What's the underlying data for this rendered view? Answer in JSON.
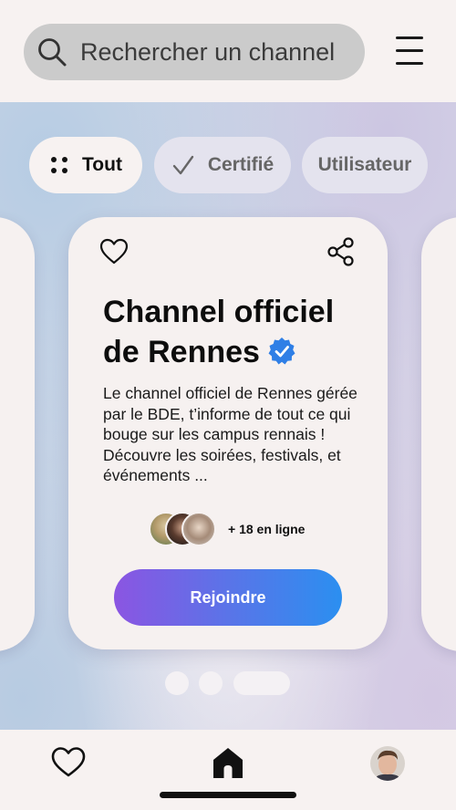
{
  "search": {
    "placeholder": "Rechercher un channel",
    "icon": "search-icon"
  },
  "header": {
    "menu_icon": "hamburger-menu-icon"
  },
  "filters": [
    {
      "label": "Tout",
      "icon": "grid-dots-icon",
      "selected": true
    },
    {
      "label": "Certifié",
      "icon": "check-icon",
      "selected": false
    },
    {
      "label": "Utilisateur",
      "selected": false
    }
  ],
  "card": {
    "title": "Channel officiel de Rennes",
    "verified": true,
    "description": "Le channel officiel de Rennes gérée par le BDE, t’informe de tout ce qui bouge sur les campus rennais ! Découvre les soirées, festivals, et événements ...",
    "online_text": "+ 18 en ligne",
    "join_label": "Rejoindre",
    "icons": [
      "heart-outline-icon",
      "share-icon",
      "verified-badge-icon"
    ]
  },
  "carousel": {
    "page_count": 3,
    "active_index": 2
  },
  "bottom_nav": {
    "items": [
      "favorites",
      "home",
      "profile"
    ],
    "active": "home"
  },
  "colors": {
    "accent_gradient_start": "#8b55e2",
    "accent_gradient_end": "#2b8ff0",
    "verified": "#2f7fe6",
    "card_bg": "#f6f1f0"
  }
}
